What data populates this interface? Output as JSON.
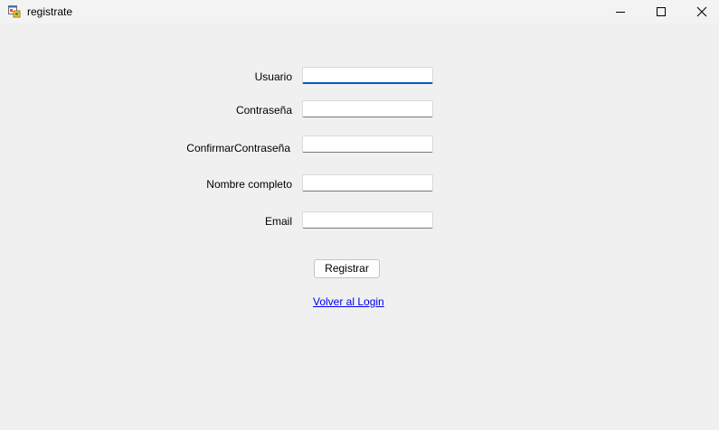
{
  "window": {
    "title": "registrate",
    "icon": "windows-form-icon",
    "controls": [
      "minimize-icon",
      "maximize-icon",
      "close-icon"
    ]
  },
  "form": {
    "usuario_label": "Usuario",
    "usuario_value": "",
    "contrasena_label": "Contraseña",
    "contrasena_value": "",
    "confirmar_label": "ConfirmarContraseña",
    "confirmar_value": "",
    "nombre_label": "Nombre completo",
    "nombre_value": "",
    "email_label": "Email",
    "email_value": "",
    "register_button": "Registrar",
    "back_link": "Volver al Login"
  },
  "colors": {
    "background": "#f0f0f0",
    "focus_accent": "#005fb8",
    "link": "#0000ee"
  }
}
